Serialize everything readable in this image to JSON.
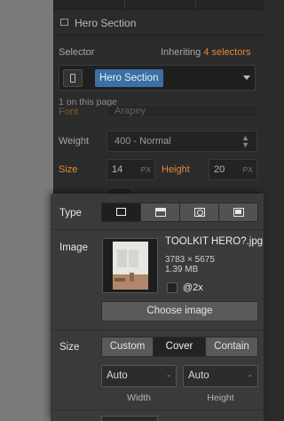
{
  "section": {
    "title": "Hero Section"
  },
  "selector": {
    "label": "Selector",
    "inheriting_prefix": "Inheriting",
    "inheriting_count": "4 selectors",
    "chip": "Hero Section",
    "on_page": "1 on this page"
  },
  "font_row": {
    "label": "Font",
    "value": "Arapey"
  },
  "weight": {
    "label": "Weight",
    "value": "400 - Normal"
  },
  "size_row": {
    "label": "Size",
    "value": "14",
    "unit": "PX"
  },
  "height_row": {
    "label": "Height",
    "value": "20",
    "unit": "PX"
  },
  "background_popup": {
    "type_label": "Type",
    "image_label": "Image",
    "image_name": "TOOLKIT HERO?.jpg",
    "image_dims": "3783 × 5675",
    "image_size": "1.39 MB",
    "retina_label": "@2x",
    "choose_button": "Choose image",
    "size_label": "Size",
    "size_options": [
      "Custom",
      "Cover",
      "Contain"
    ],
    "width": {
      "value": "Auto",
      "unit": "-",
      "caption": "Width"
    },
    "height": {
      "value": "Auto",
      "unit": "-",
      "caption": "Height"
    }
  }
}
